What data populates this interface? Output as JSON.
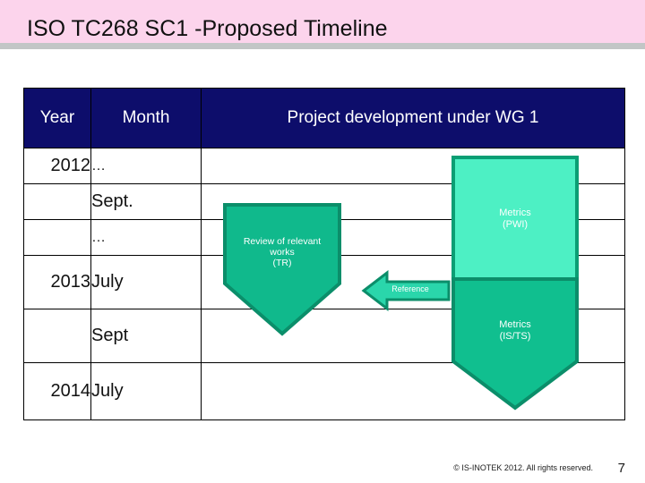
{
  "slide": {
    "title": "ISO TC268 SC1 -Proposed Timeline",
    "banner_color": "#fcd4ec",
    "rule_color": "#c2c6c6"
  },
  "table": {
    "header_bg": "#0d0d6b",
    "header_fg": "#ffffff",
    "columns": [
      "Year",
      "Month",
      "Project development under WG 1"
    ],
    "rows": [
      {
        "year": "2012",
        "month": "…"
      },
      {
        "year": "",
        "month": "Sept."
      },
      {
        "year": "",
        "month": "…"
      },
      {
        "year": "2013",
        "month": "July"
      },
      {
        "year": "",
        "month": "Sept"
      },
      {
        "year": "2014",
        "month": "July"
      }
    ]
  },
  "shapes": {
    "review": {
      "label": "Review of relevant\nworks\n(TR)",
      "color": "#10b98c",
      "outline": "#0b8e6a"
    },
    "metrics_pwi": {
      "label": "Metrics\n(PWI)",
      "color": "#4df0c4",
      "outline": "#0b9e74"
    },
    "metrics_ists": {
      "label": "Metrics\n(IS/TS)",
      "color": "#10bf8f",
      "outline": "#0b8e6a"
    },
    "reference_arrow": {
      "label": "Reference",
      "color": "#2ad6ab",
      "outline": "#0b8e6a"
    }
  },
  "footer": {
    "copyright": "© IS-INOTEK 2012. All rights reserved.",
    "page_number": "7"
  }
}
